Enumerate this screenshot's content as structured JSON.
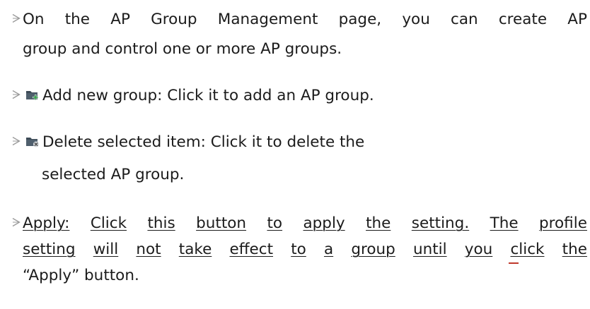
{
  "bullets": [
    {
      "lines": [
        "On the AP Group Management page, you can create AP",
        "group and control one or more AP groups."
      ]
    },
    {
      "icon": "add-folder-icon",
      "text": "Add new group: Click it to add an AP group."
    },
    {
      "icon": "delete-folder-icon",
      "lines": [
        "Delete selected item: Click it to delete the",
        "selected AP group."
      ]
    },
    {
      "lines": [
        "Apply: Click this button to apply the setting. The profile",
        "setting will not take effect to a group until you click the",
        "“Apply” button."
      ]
    }
  ]
}
